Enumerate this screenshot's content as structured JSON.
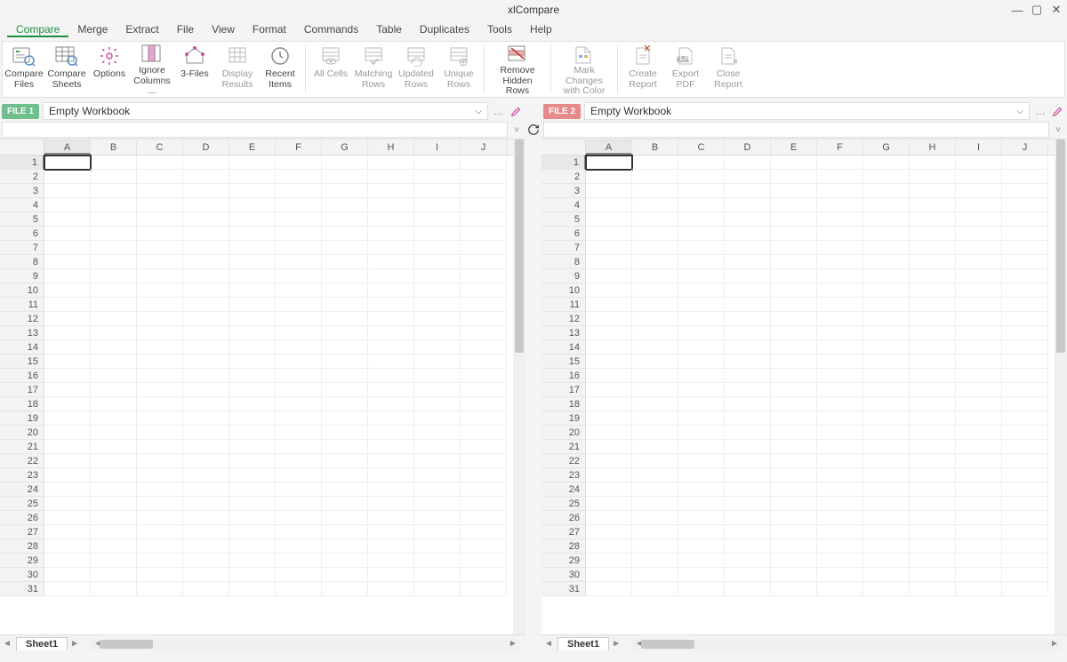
{
  "app_title": "xlCompare",
  "menu": [
    "Compare",
    "Merge",
    "Extract",
    "File",
    "View",
    "Format",
    "Commands",
    "Table",
    "Duplicates",
    "Tools",
    "Help"
  ],
  "active_menu": 0,
  "ribbon": [
    {
      "id": "compare-files",
      "label": "Compare\nFiles"
    },
    {
      "id": "compare-sheets",
      "label": "Compare\nSheets"
    },
    {
      "id": "options",
      "label": "Options"
    },
    {
      "id": "ignore-columns",
      "label": "Ignore\nColumns ..."
    },
    {
      "id": "three-files",
      "label": "3-Files"
    },
    {
      "id": "display-results",
      "label": "Display\nResults",
      "muted": true
    },
    {
      "id": "recent-items",
      "label": "Recent\nItems"
    },
    {
      "sep": true
    },
    {
      "id": "all-cells",
      "label": "All Cells",
      "muted": true
    },
    {
      "id": "matching-rows",
      "label": "Matching\nRows",
      "muted": true
    },
    {
      "id": "updated-rows",
      "label": "Updated\nRows",
      "muted": true
    },
    {
      "id": "unique-rows",
      "label": "Unique\nRows",
      "muted": true
    },
    {
      "sep": true
    },
    {
      "id": "remove-hidden",
      "label": "Remove\nHidden Rows",
      "wide": true
    },
    {
      "sep": true
    },
    {
      "id": "mark-changes",
      "label": "Mark Changes\nwith Color",
      "muted": true,
      "wide": true
    },
    {
      "sep": true
    },
    {
      "id": "create-report",
      "label": "Create\nReport",
      "muted": true
    },
    {
      "id": "export-pdf",
      "label": "Export\nPDF",
      "muted": true
    },
    {
      "id": "close-report",
      "label": "Close\nReport",
      "muted": true
    }
  ],
  "panes": [
    {
      "badge": "FILE 1",
      "badge_class": "g",
      "workbook": "Empty Workbook",
      "sheet": "Sheet1"
    },
    {
      "badge": "FILE 2",
      "badge_class": "r",
      "workbook": "Empty Workbook",
      "sheet": "Sheet1"
    }
  ],
  "columns": [
    "A",
    "B",
    "C",
    "D",
    "E",
    "F",
    "G",
    "H",
    "I",
    "J"
  ],
  "row_count": 31,
  "selected_cell": {
    "row": 1,
    "col": "A"
  }
}
